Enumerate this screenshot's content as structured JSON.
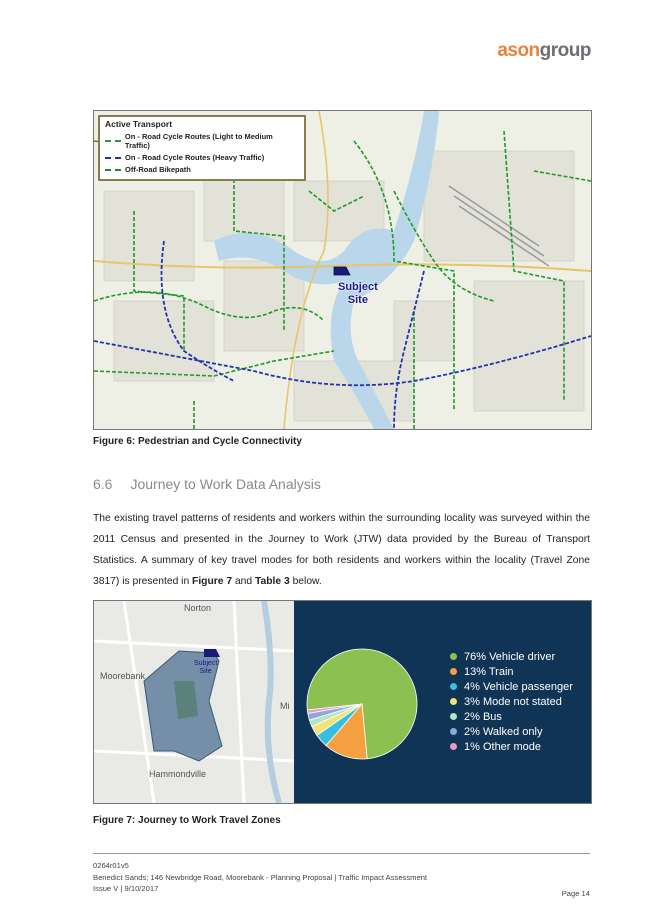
{
  "header": {
    "logo_part1": "ason",
    "logo_part2": "group"
  },
  "figure6": {
    "legend_title": "Active Transport",
    "legend_items": [
      {
        "label": "On - Road Cycle Routes (Light to Medium Traffic)",
        "color": "#2e9a3a"
      },
      {
        "label": "On - Road Cycle Routes (Heavy Traffic)",
        "color": "#2233aa"
      },
      {
        "label": "Off-Road Bikepath",
        "color": "#1d8a2a"
      }
    ],
    "site_label_1": "Subject",
    "site_label_2": "Site",
    "caption": "Figure 6: Pedestrian and Cycle Connectivity"
  },
  "section": {
    "number": "6.6",
    "title": "Journey to Work Data Analysis"
  },
  "paragraph": {
    "part1": "The existing travel patterns of residents and workers within the surrounding locality was surveyed within the 2011 Census and presented in the Journey to Work (JTW) data provided by the Bureau of Transport Statistics.  A summary of key travel modes for both residents and workers within the locality (Travel Zone 3817) is presented in ",
    "fig_ref": "Figure 7",
    "part2": " and ",
    "table_ref": "Table 3",
    "part3": " below."
  },
  "figure7": {
    "map_labels": {
      "north": "Norton",
      "west": "Moorebank",
      "south": "Hammondville",
      "east": "Mi",
      "site1": "Subject",
      "site2": "Site"
    },
    "caption": "Figure 7: Journey to Work Travel Zones"
  },
  "chart_data": {
    "type": "pie",
    "slices": [
      {
        "label": "76% Vehicle driver",
        "value": 76,
        "color": "#8cc152"
      },
      {
        "label": "13% Train",
        "value": 13,
        "color": "#f5a141"
      },
      {
        "label": "4% Vehicle passenger",
        "value": 4,
        "color": "#37bfe0"
      },
      {
        "label": "3% Mode not stated",
        "value": 3,
        "color": "#f2e27a"
      },
      {
        "label": "2% Bus",
        "value": 2,
        "color": "#b7e3c4"
      },
      {
        "label": "2% Walked only",
        "value": 2,
        "color": "#8fa7dd"
      },
      {
        "label": "1% Other mode",
        "value": 1,
        "color": "#e99bc4"
      }
    ],
    "legend": "right"
  },
  "footer": {
    "doc_id": "0264r01v5",
    "project": "Benedict Sands; 146 Newbridge Road, Moorebank - Planning Proposal | Traffic Impact Assessment",
    "issue": "Issue V | 9/10/2017",
    "page": "Page 14"
  }
}
